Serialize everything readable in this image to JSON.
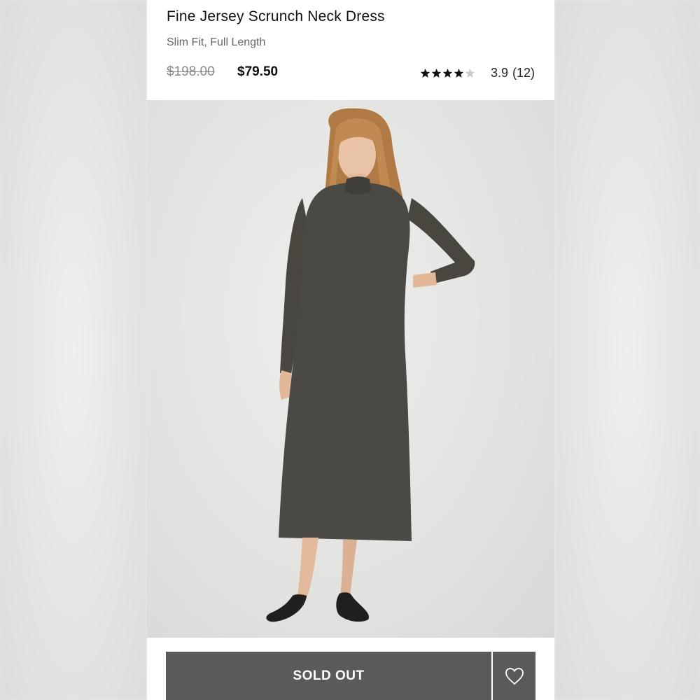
{
  "product": {
    "title": "Fine Jersey Scrunch Neck Dress",
    "subtitle": "Slim Fit, Full Length",
    "original_price": "$198.00",
    "sale_price": "$79.50"
  },
  "rating": {
    "value": "3.9",
    "count": "(12)",
    "stars_filled": 4,
    "stars_total": 5,
    "filled_color": "#111111",
    "empty_color": "#cccccc"
  },
  "image": {
    "icon": "product-photo"
  },
  "actions": {
    "primary_label": "SOLD OUT",
    "wishlist_icon": "heart-icon",
    "button_color": "#5a5a5a"
  }
}
